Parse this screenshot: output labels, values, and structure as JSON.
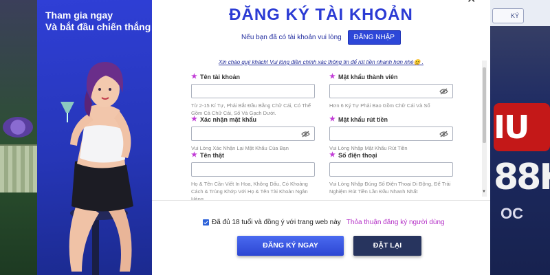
{
  "promo": {
    "line1": "Tham gia ngay",
    "line2": "Và bắt đầu chiến thắng"
  },
  "modal": {
    "title": "ĐĂNG KÝ TÀI KHOẢN",
    "login_prompt": "Nếu bạn đã có tài khoản vui lòng",
    "login_button": "ĐĂNG NHẬP",
    "greeting": "Xin chào quý khách! Vui lòng điền chính xác thông tin để rút tiền nhanh hơn nhé😊 ."
  },
  "fields": {
    "username": {
      "label": "Tên tài khoản",
      "value": "",
      "hint": "Từ 2-15 Kí Tự, Phải Bắt Đầu Bằng Chữ Cái, Có Thể Gồm Cả Chữ Cái, Số Và Gạch Dưới."
    },
    "password": {
      "label": "Mật khẩu thành viên",
      "value": "",
      "hint": "Hơn 6 Ký Tự Phải Bao Gồm Chữ Cái Và Số"
    },
    "confirm_password": {
      "label": "Xác nhận mật khẩu",
      "value": "",
      "hint": "Vui Lòng Xác Nhận Lại Mật Khẩu Của Bạn"
    },
    "withdraw_password": {
      "label": "Mật khẩu rút tiền",
      "value": "",
      "hint": "Vui Lòng Nhập Mật Khẩu Rút Tiền"
    },
    "real_name": {
      "label": "Tên thật",
      "value": "",
      "hint": "Họ & Tên Cần Viết In Hoa, Không Dấu, Có Khoảng Cách & Trùng Khớp Với Họ & Tên Tài Khoản Ngân Hàng."
    },
    "phone": {
      "label": "Số điện thoại",
      "value": "",
      "hint": "Vui Lòng Nhập Đúng Số Điện Thoại Di Động, Để Trải Nghiệm Rút Tiền Lần Đầu Nhanh Nhất"
    }
  },
  "agreement": {
    "checked": true,
    "text": "Đã đủ 18 tuổi và đồng ý với trang web này",
    "terms_link": "Thỏa thuận đăng ký người dùng"
  },
  "actions": {
    "submit": "ĐĂNG KÝ NGAY",
    "reset": "ĐẶT LẠI"
  },
  "background": {
    "top_button": "KÝ",
    "banner_red": "IU",
    "banner_big": "88K",
    "banner_small": "OC"
  },
  "colors": {
    "brand_blue": "#2b3bd4",
    "accent_purple": "#b431c7",
    "reset_navy": "#27345e"
  },
  "icons": {
    "close": "close-icon",
    "required": "star-icon",
    "toggle_password": "eye-slash-icon",
    "checkbox": "check-icon"
  }
}
